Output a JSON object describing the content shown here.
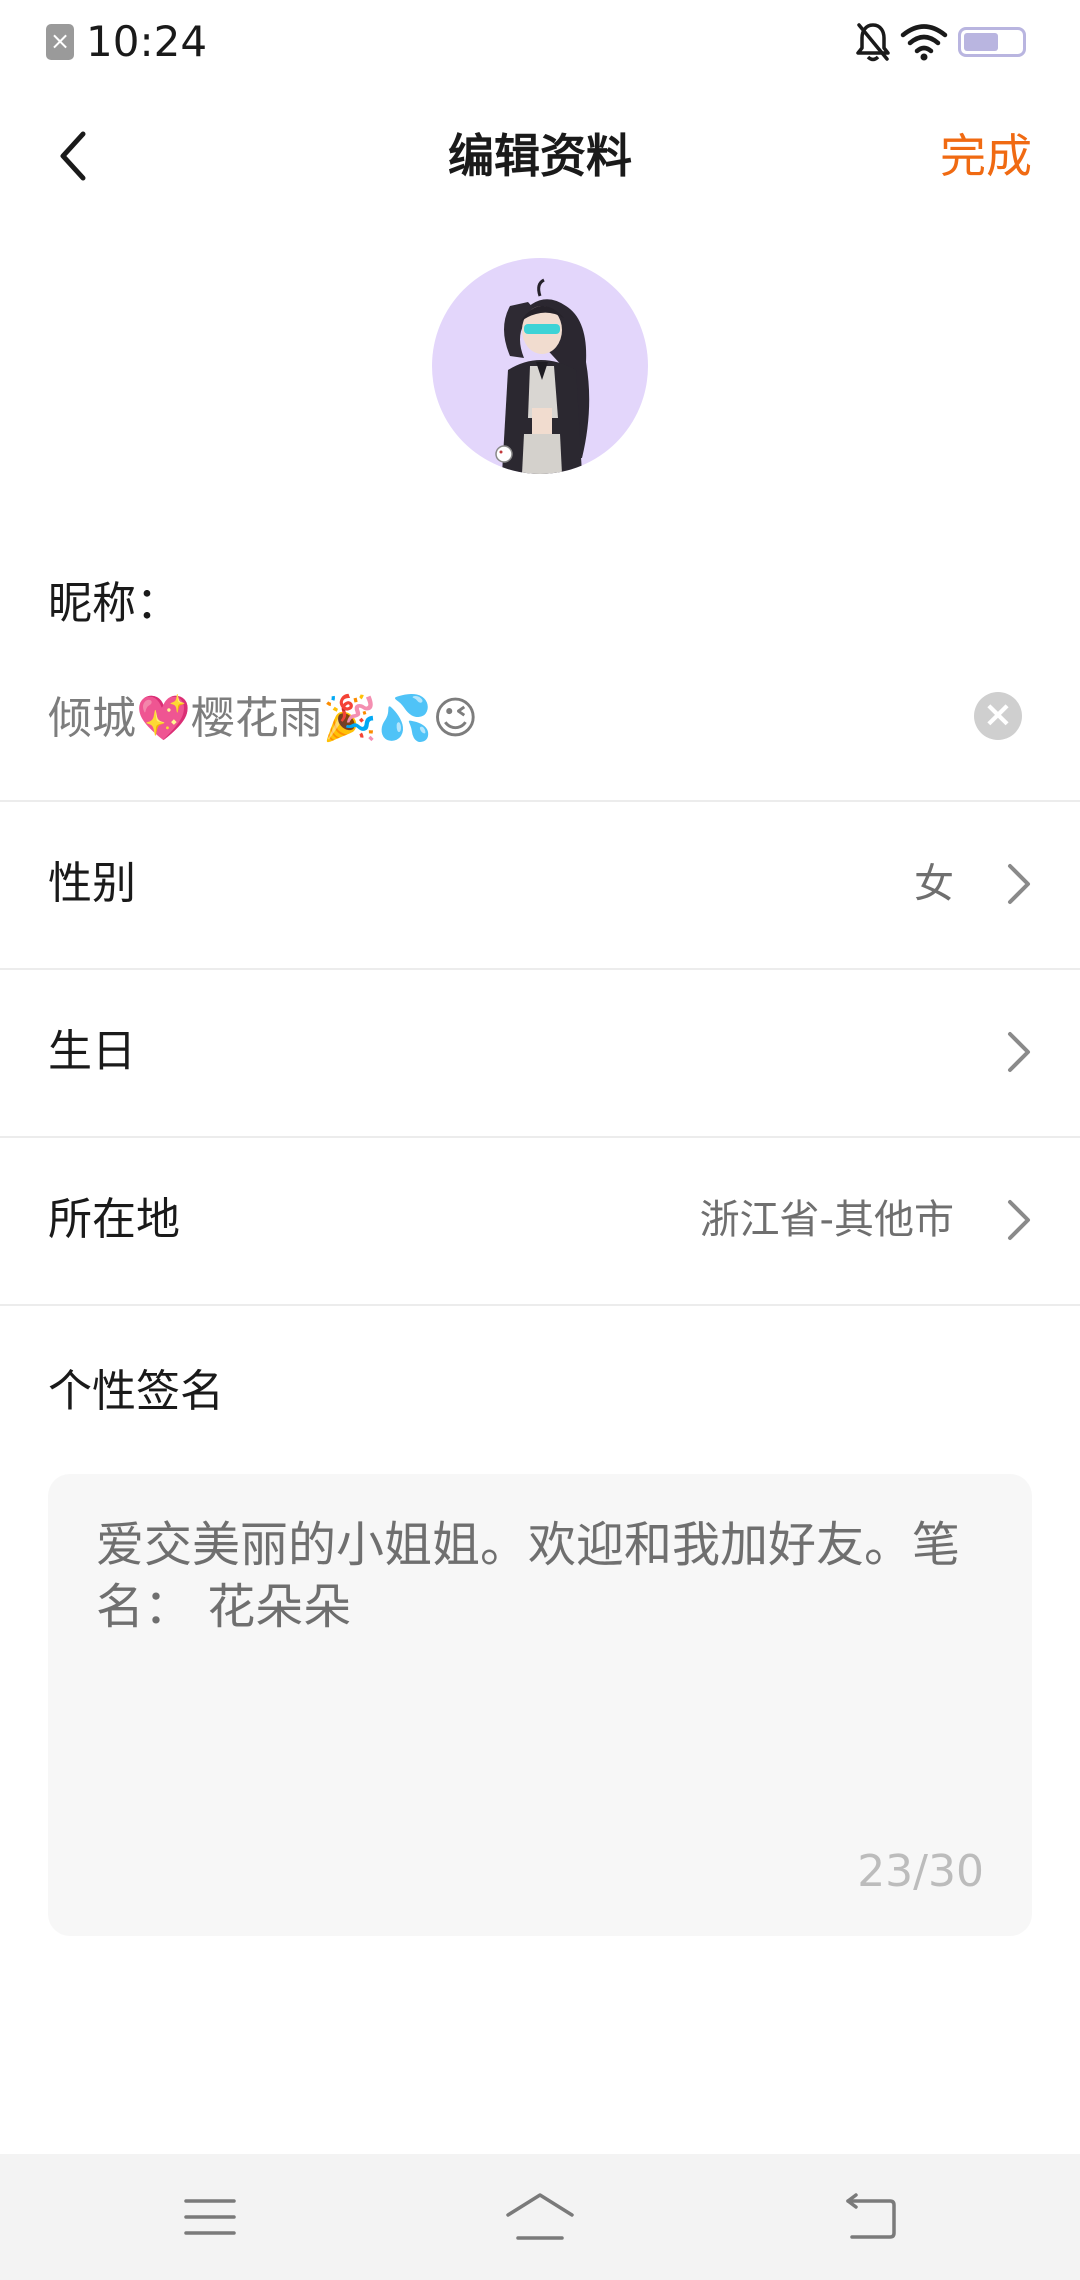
{
  "status_bar": {
    "time": "10:24",
    "icons": [
      "sim-error-icon",
      "bell-off-icon",
      "wifi-icon",
      "battery-icon"
    ],
    "battery_color": "#b9b5e0"
  },
  "header": {
    "title": "编辑资料",
    "back_icon": "back-arrow-icon",
    "done_label": "完成",
    "accent_color": "#f06a12"
  },
  "avatar": {
    "background_color": "#e3d6fb"
  },
  "nickname": {
    "label": "昵称：",
    "value": "倾城💖樱花雨🎉💦😉",
    "clear_icon": "clear-icon"
  },
  "fields": [
    {
      "label": "性别",
      "value": "女"
    },
    {
      "label": "生日",
      "value": ""
    },
    {
      "label": "所在地",
      "value": "浙江省-其他市"
    }
  ],
  "signature": {
    "label": "个性签名",
    "text": "爱交美丽的小姐姐。欢迎和我加好友。笔名：  花朵朵",
    "counter": "23/30"
  },
  "nav_bar": {
    "icons": [
      "menu-icon",
      "home-icon",
      "back-icon"
    ]
  }
}
